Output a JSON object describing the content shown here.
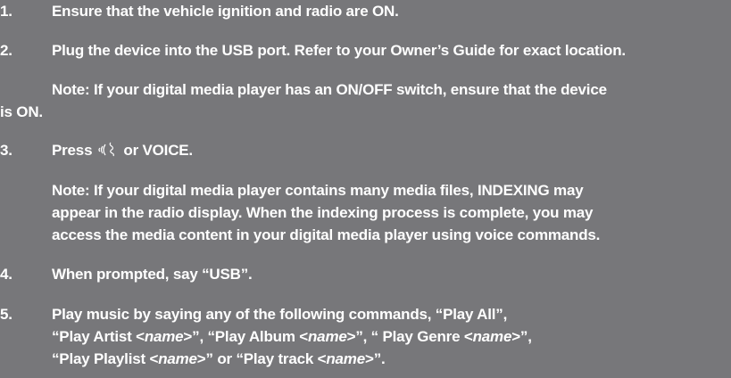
{
  "steps": [
    {
      "number": "1.",
      "text": "Ensure that the vehicle ignition and radio are ON."
    },
    {
      "number": "2.",
      "text": "Plug the device into the USB port.  Refer to your Owner’s Guide for exact location.",
      "note_line1": "Note:  If your digital media player has an ON/OFF switch, ensure that the device",
      "note_line2": "is ON."
    },
    {
      "number": "3.",
      "text_before_icon": "Press",
      "icon": "voice-icon",
      "text_after_icon": "or VOICE.",
      "note_line1": "Note:  If your digital media player contains many media files, INDEXING may",
      "note_line2": "appear in the radio display.  When the indexing process is complete, you may",
      "note_line3": "access the media content in your digital media player using voice commands."
    },
    {
      "number": "4.",
      "text": "When prompted, say “USB”."
    },
    {
      "number": "5.",
      "line1": "Play music by saying any of the following commands, “Play All”,",
      "line2_a": "“Play Artist <",
      "line2_b": "name",
      "line2_c": ">”, “Play Album <",
      "line2_d": "name",
      "line2_e": ">”, “ Play Genre <",
      "line2_f": "name",
      "line2_g": ">”,",
      "line3_a": "“Play Playlist <",
      "line3_b": "name",
      "line3_c": ">” or “Play track <",
      "line3_d": "name",
      "line3_e": ">”."
    }
  ]
}
